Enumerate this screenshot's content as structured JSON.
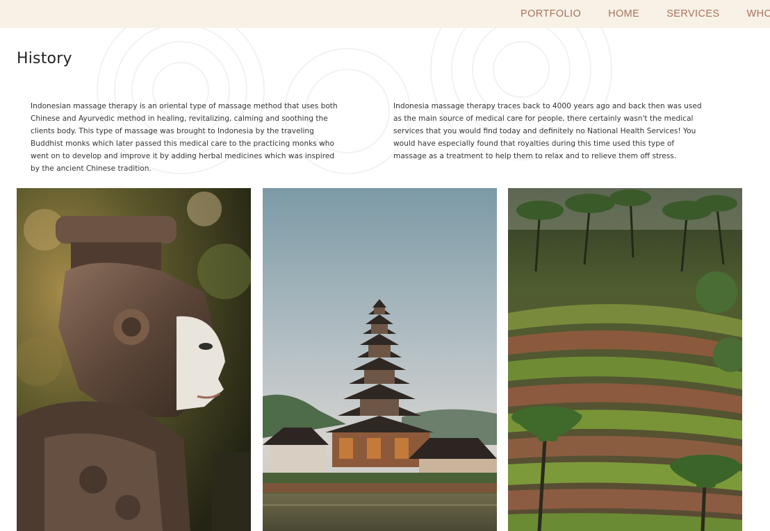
{
  "nav": {
    "items": [
      {
        "label": "PORTFOLIO"
      },
      {
        "label": "HOME"
      },
      {
        "label": "SERVICES"
      },
      {
        "label": "WHO"
      }
    ]
  },
  "page": {
    "title": "History"
  },
  "content": {
    "paragraph_left": "Indonesian massage therapy is an oriental type of massage method that uses both Chinese and Ayurvedic method in healing, revitalizing, calming and soothing the clients body. This type of massage was brought to Indonesia by the traveling Buddhist monks which later passed this medical care to the practicing monks who went on to develop and improve it by adding herbal medicines which was inspired by the ancient Chinese tradition.",
    "paragraph_right": "Indonesia massage therapy traces back to 4000 years ago and back then was used as the main source of medical care for people, there certainly wasn't the medical services that you would find today and definitely no National Health Services! You would have especially found that royalties during this time used this type of massage as a treatment to help them to relax and to relieve them off stress."
  },
  "colors": {
    "nav_bg": "#f7f1e6",
    "nav_text": "#a8725b",
    "title_text": "#222222"
  }
}
